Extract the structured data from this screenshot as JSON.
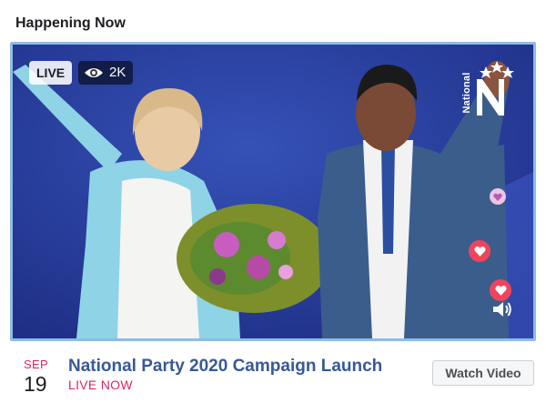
{
  "section": {
    "title": "Happening Now"
  },
  "video": {
    "live_label": "LIVE",
    "viewer_count": "2K",
    "brand_logo_text": "National",
    "brand_logo_letter": "N",
    "reaction_icons": [
      "heart-reaction-icon",
      "heart-reaction-icon",
      "heart-reaction-icon"
    ],
    "volume_icon": "volume-icon"
  },
  "event": {
    "month": "SEP",
    "day": "19",
    "title": "National Party 2020 Campaign Launch",
    "status": "LIVE NOW",
    "watch_button_label": "Watch Video"
  },
  "colors": {
    "accent_link": "#385898",
    "live_red": "#e0245e",
    "frame_border": "#8fbbe8",
    "stage_blue": "#2b3f9a"
  }
}
